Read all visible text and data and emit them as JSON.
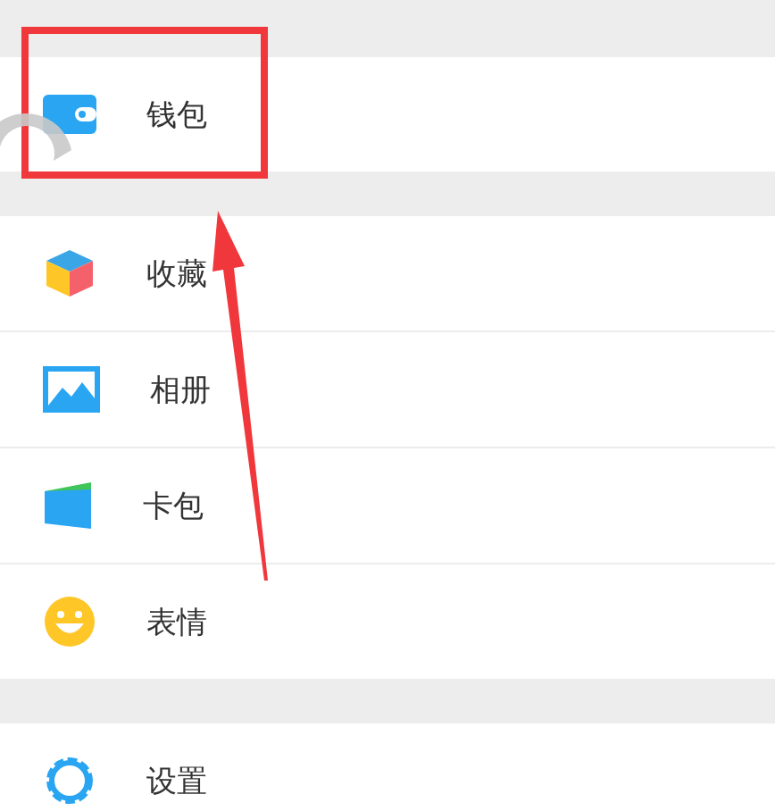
{
  "groups": [
    {
      "items": [
        {
          "kind": "wallet",
          "label": "钱包"
        }
      ]
    },
    {
      "items": [
        {
          "kind": "cube",
          "label": "收藏"
        },
        {
          "kind": "photo",
          "label": "相册"
        },
        {
          "kind": "cards",
          "label": "卡包"
        },
        {
          "kind": "smile",
          "label": "表情"
        }
      ]
    },
    {
      "items": [
        {
          "kind": "gear",
          "label": "设置"
        }
      ]
    }
  ],
  "annotation": {
    "kind": "frame_arrow"
  }
}
